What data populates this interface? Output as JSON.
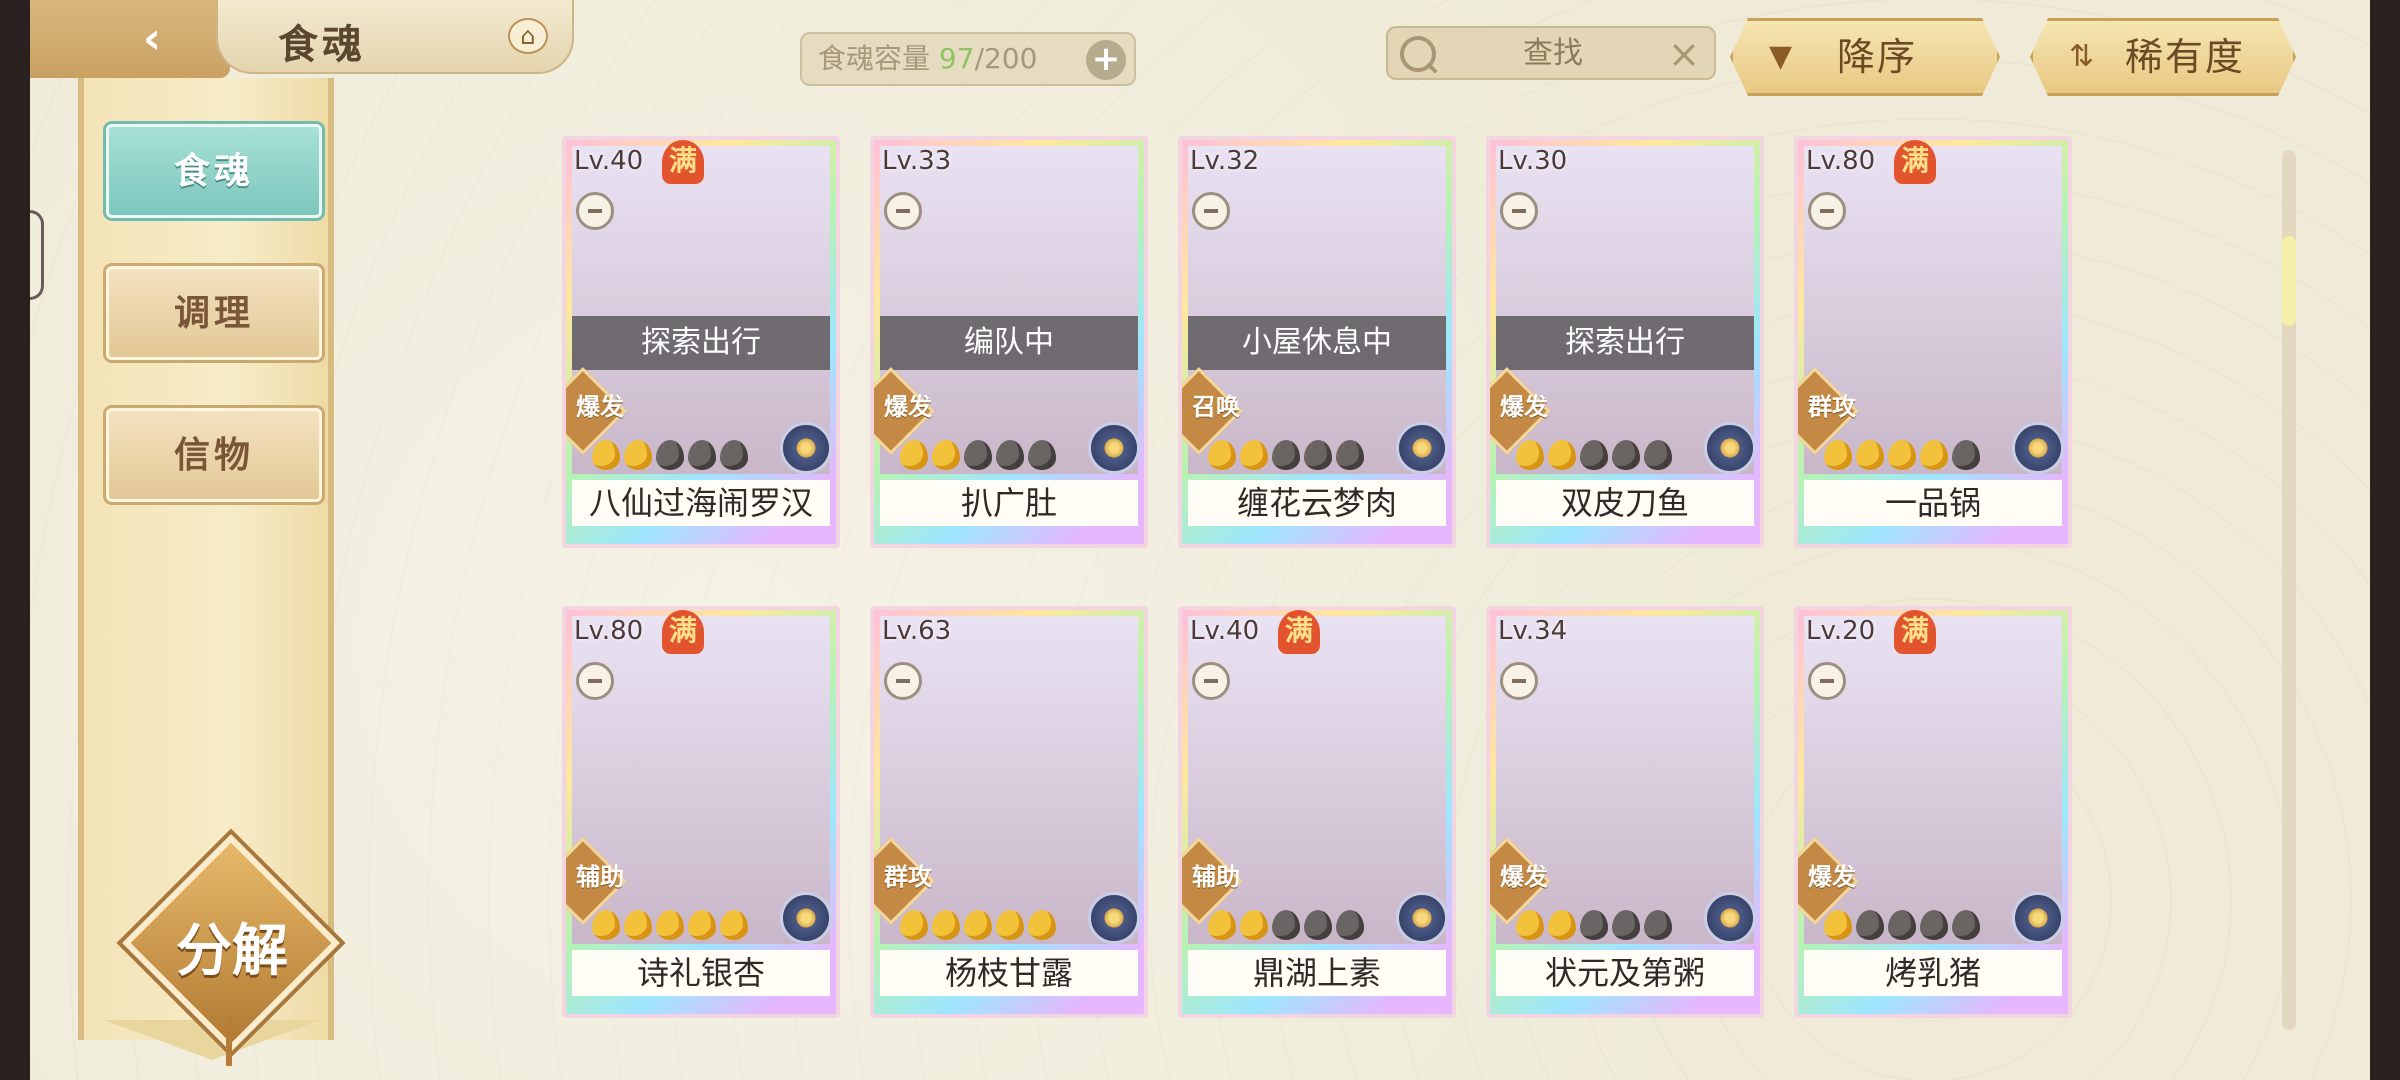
{
  "header": {
    "title": "食魂",
    "back_icon": "chevron-left-icon",
    "home_icon": "pavilion-icon"
  },
  "capacity": {
    "label": "食魂容量",
    "current": "97",
    "max": "/200"
  },
  "search": {
    "placeholder": "查找"
  },
  "sort": {
    "order_label": "降序",
    "field_label": "稀有度"
  },
  "sidebar": {
    "tabs": [
      {
        "label": "食魂",
        "active": true
      },
      {
        "label": "调理",
        "active": false
      },
      {
        "label": "信物",
        "active": false
      }
    ],
    "decompose_label": "分解"
  },
  "cards": [
    {
      "level": "Lv.40",
      "full": "满",
      "status": "探索出行",
      "role": "爆发",
      "stars": 2,
      "name": "八仙过海闹罗汉"
    },
    {
      "level": "Lv.33",
      "full": "",
      "status": "编队中",
      "role": "爆发",
      "stars": 2,
      "name": "扒广肚"
    },
    {
      "level": "Lv.32",
      "full": "",
      "status": "小屋休息中",
      "role": "召唤",
      "stars": 2,
      "name": "缠花云梦肉"
    },
    {
      "level": "Lv.30",
      "full": "",
      "status": "探索出行",
      "role": "爆发",
      "stars": 2,
      "name": "双皮刀鱼"
    },
    {
      "level": "Lv.80",
      "full": "满",
      "status": "",
      "role": "群攻",
      "stars": 4,
      "name": "一品锅"
    },
    {
      "level": "Lv.80",
      "full": "满",
      "status": "",
      "role": "辅助",
      "stars": 5,
      "name": "诗礼银杏"
    },
    {
      "level": "Lv.63",
      "full": "",
      "status": "",
      "role": "群攻",
      "stars": 5,
      "name": "杨枝甘露"
    },
    {
      "level": "Lv.40",
      "full": "满",
      "status": "",
      "role": "辅助",
      "stars": 2,
      "name": "鼎湖上素"
    },
    {
      "level": "Lv.34",
      "full": "",
      "status": "",
      "role": "爆发",
      "stars": 2,
      "name": "状元及第粥"
    },
    {
      "level": "Lv.20",
      "full": "满",
      "status": "",
      "role": "爆发",
      "stars": 1,
      "name": "烤乳猪"
    }
  ],
  "colors": {
    "accent_teal": "#7cc7bd",
    "gold": "#e7c982",
    "capacity_current": "#8fc562"
  }
}
